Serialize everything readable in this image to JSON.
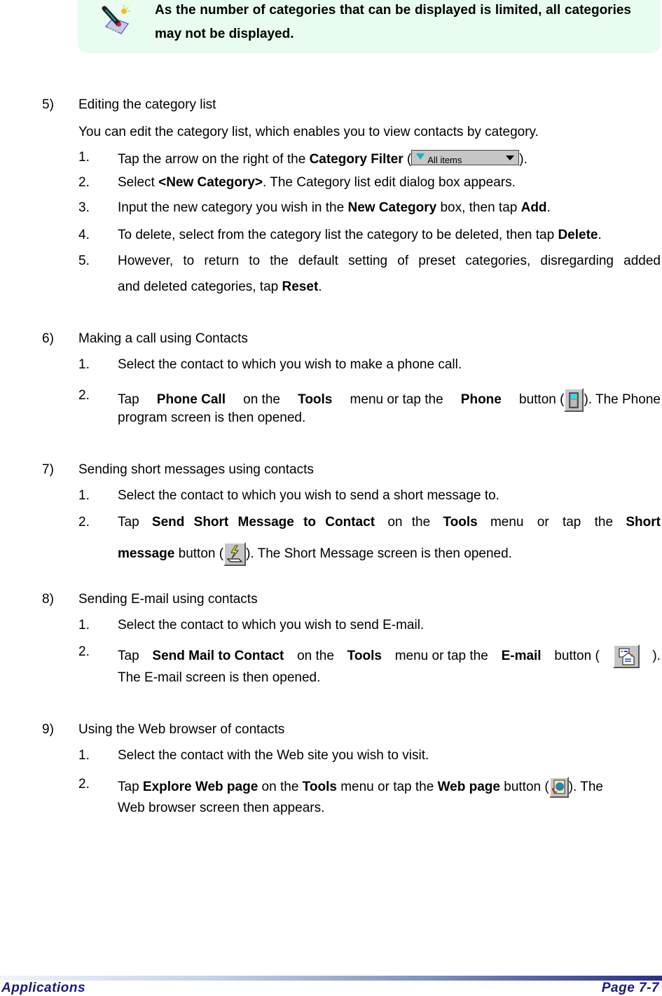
{
  "note": {
    "icon": "pencil-note-icon",
    "text": "As the number of categories that can be displayed is limited, all categories may not be displayed."
  },
  "sections": {
    "s5": {
      "num": "5)",
      "title": "Editing the category list",
      "intro": "You can edit the category list, which enables you to view contacts by category.",
      "steps": [
        {
          "num": "1.",
          "pre": "Tap the arrow on the right of the ",
          "bold": "Category Filter",
          "post_open": " (",
          "post": ")."
        },
        {
          "num": "2.",
          "pre": "Select ",
          "bold": "<New Category>",
          "post": ". The Category list edit dialog box appears."
        },
        {
          "num": "3.",
          "pre": "Input the new category you wish in the ",
          "bold": "New Category",
          "mid": " box, then tap ",
          "bold2": "Add",
          "post": "."
        },
        {
          "num": "4.",
          "pre": "To delete, select from the category list the category to be deleted, then tap ",
          "bold": "Delete",
          "post": "."
        },
        {
          "num": "5.",
          "line1": "However, to return to the default setting of preset categories, disregarding added",
          "pre": "and deleted categories, tap ",
          "bold": "Reset",
          "post": "."
        }
      ],
      "combo_label": "All items"
    },
    "s6": {
      "num": "6)",
      "title": "Making a call using Contacts",
      "steps": [
        {
          "num": "1.",
          "text": "Select the contact to which you wish to make a phone call."
        },
        {
          "num": "2.",
          "w1": "Tap",
          "b1": "Phone Call",
          "w2": "on the",
          "b2": "Tools",
          "w3": "menu or tap the",
          "b3": "Phone",
          "w4": "button (",
          "w5": "). The Phone",
          "line2": "program screen is then opened."
        }
      ]
    },
    "s7": {
      "num": "7)",
      "title": "Sending short messages using contacts",
      "steps": [
        {
          "num": "1.",
          "text": "Select the contact to which you wish to send a short message to."
        },
        {
          "num": "2.",
          "w1": "Tap",
          "b1": "Send Short Message to Contact",
          "w2": "on the",
          "b2": "Tools",
          "w3": "menu or tap the",
          "b3": "Short",
          "b4": "message",
          "w4": " button (",
          "w5": "). The Short Message screen is then opened."
        }
      ]
    },
    "s8": {
      "num": "8)",
      "title": "Sending E-mail using contacts",
      "steps": [
        {
          "num": "1.",
          "text": "Select the contact to which you wish to send E-mail."
        },
        {
          "num": "2.",
          "w1": "Tap",
          "b1": "Send Mail to Contact",
          "w2": "on the",
          "b2": "Tools",
          "w3": "menu or tap the",
          "b3": "E-mail",
          "w4": "button (",
          "w5": ").",
          "line2": "The E-mail screen is then opened."
        }
      ]
    },
    "s9": {
      "num": "9)",
      "title": "Using the Web browser of contacts",
      "steps": [
        {
          "num": "1.",
          "text": "Select the contact with the Web site you wish to visit."
        },
        {
          "num": "2.",
          "w1": "Tap ",
          "b1": "Explore Web page",
          "w2": " on the ",
          "b2": "Tools",
          "w3": " menu or tap the ",
          "b3": "Web page",
          "w4": " button (",
          "w5": "). The",
          "line2": "Web browser screen then appears."
        }
      ]
    }
  },
  "footer": {
    "left": "Applications",
    "right": "Page 7-7"
  }
}
